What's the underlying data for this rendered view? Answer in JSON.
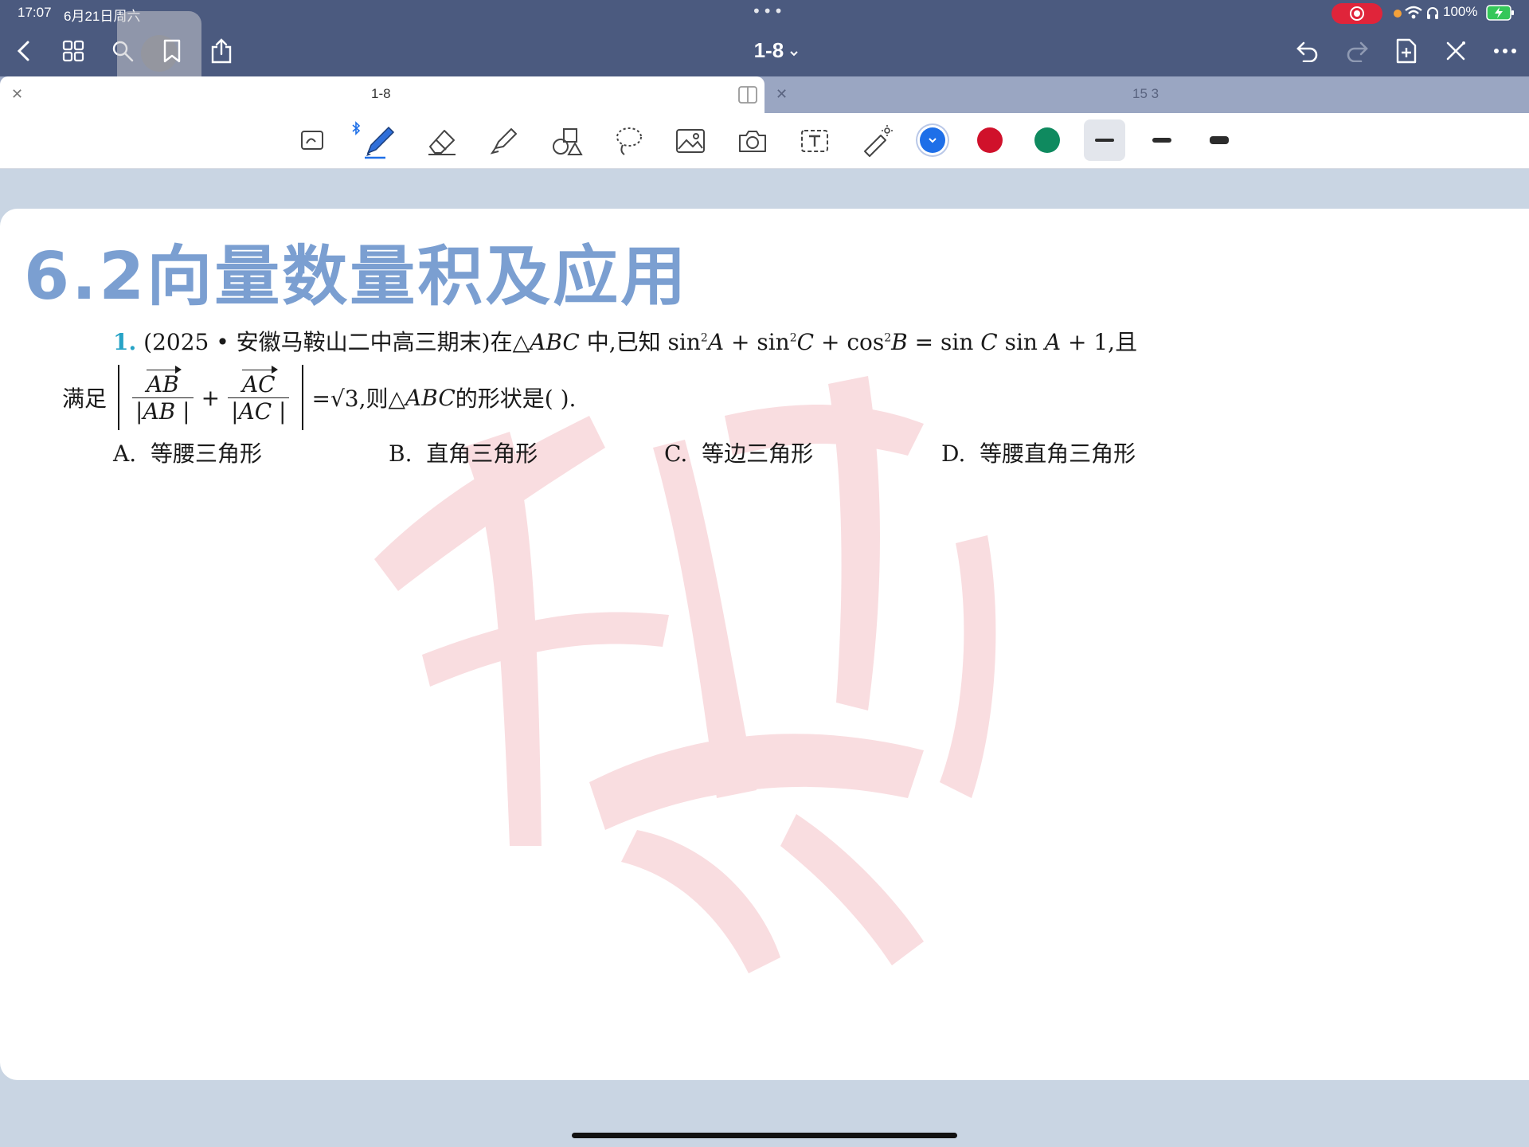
{
  "status": {
    "time": "17:07",
    "date": "6月21日周六",
    "battery": "100%"
  },
  "nav": {
    "title": "1-8",
    "left_icons": [
      "back-icon",
      "grid-icon",
      "search-icon",
      "bookmark-icon",
      "share-icon"
    ],
    "right_icons": [
      "undo-icon",
      "redo-icon",
      "add-page-icon",
      "close-icon",
      "more-icon"
    ]
  },
  "tabs": [
    {
      "label": "1-8",
      "active": true
    },
    {
      "label": "15 3",
      "active": false
    }
  ],
  "toolbar": {
    "tools": [
      "read-mode-icon",
      "pen-icon",
      "eraser-icon",
      "highlighter-icon",
      "shapes-icon",
      "lasso-icon",
      "image-icon",
      "camera-icon",
      "text-icon",
      "laser-pointer-icon"
    ],
    "colors": [
      "#1e6fe8",
      "#d0112b",
      "#0f8a5f"
    ],
    "selected_color": "#1e6fe8",
    "stroke_sizes": [
      "thin",
      "medium",
      "thick"
    ],
    "selected_stroke": "thin"
  },
  "document": {
    "section_title": "6.2向量数量积及应用",
    "question": {
      "number": "1.",
      "line1_text": "(2025 • 安徽马鞍山二中高三期末)在△ABC 中,已知 sin²A + sin²C + cos²B = sin C sin A + 1,且",
      "line1_prefix": "(2025 • 安徽马鞍山二中高三期末)在△",
      "line1_abc": "ABC",
      "line1_mid": " 中,已知 sin",
      "line1_sup": "2",
      "line1_a": "A",
      "line1_plus_sin": " + sin",
      "line1_c": "C",
      "line1_plus_cos": " + cos",
      "line1_b": "B",
      "line1_eq": " = sin ",
      "line1_c2": "C",
      "line1_sin2": " sin ",
      "line1_a2": "A",
      "line1_tail": " + 1,且",
      "line2_prefix": "满足",
      "vec_ab": "AB",
      "vec_ac": "AC",
      "den_ab": "|AB |",
      "den_ac": "|AC |",
      "plus": "+",
      "line2_eq": "=√3,则△",
      "line2_abc": "ABC",
      "line2_tail": " 的形状是(        )."
    },
    "options": [
      {
        "letter": "A.",
        "text": "等腰三角形"
      },
      {
        "letter": "B.",
        "text": "直角三角形"
      },
      {
        "letter": "C.",
        "text": "等边三角形"
      },
      {
        "letter": "D.",
        "text": "等腰直角三角形"
      }
    ]
  }
}
